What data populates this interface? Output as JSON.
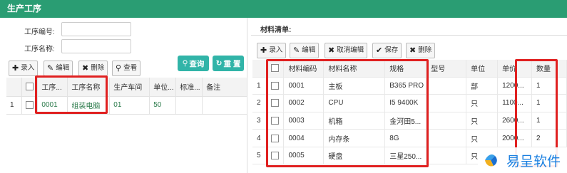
{
  "header": {
    "title": "生产工序"
  },
  "left": {
    "form": {
      "code_label": "工序编号:",
      "name_label": "工序名称:",
      "code_value": "",
      "name_value": ""
    },
    "toolbar": {
      "add": "录入",
      "edit": "编辑",
      "delete": "删除",
      "view": "查看",
      "query": "查询",
      "reset": "重 置"
    },
    "table": {
      "headers": [
        "工序...",
        "工序名称",
        "生产车间",
        "单位...",
        "标准...",
        "备注"
      ],
      "rows": [
        {
          "index": "1",
          "code": "0001",
          "name": "组装电脑",
          "workshop": "01",
          "unit": "50",
          "std": "",
          "note": ""
        }
      ]
    }
  },
  "right": {
    "title": "材料清单:",
    "toolbar": {
      "add": "录入",
      "edit": "编辑",
      "cancel_edit": "取消编辑",
      "save": "保存",
      "delete": "删除"
    },
    "table": {
      "headers": [
        "材料编码",
        "材料名称",
        "规格",
        "型号",
        "单位",
        "单价",
        "数量"
      ],
      "rows": [
        {
          "index": "1",
          "code": "0001",
          "name": "主板",
          "spec": "B365 PRO",
          "model": "",
          "unit": "部",
          "price": "1200...",
          "qty": "1"
        },
        {
          "index": "2",
          "code": "0002",
          "name": "CPU",
          "spec": "I5 9400K",
          "model": "",
          "unit": "只",
          "price": "1100...",
          "qty": "1"
        },
        {
          "index": "3",
          "code": "0003",
          "name": "机箱",
          "spec": "金河田5...",
          "model": "",
          "unit": "只",
          "price": "2600...",
          "qty": "1"
        },
        {
          "index": "4",
          "code": "0004",
          "name": "内存条",
          "spec": "8G",
          "model": "",
          "unit": "只",
          "price": "2000...",
          "qty": "2"
        },
        {
          "index": "5",
          "code": "0005",
          "name": "硬盘",
          "spec": "三星250...",
          "model": "",
          "unit": "只",
          "price": "",
          "qty": ""
        }
      ]
    }
  },
  "watermark": {
    "text": "易呈软件"
  },
  "colors": {
    "header_bg": "#2a9d73",
    "accent_button": "#31b4a8",
    "highlight_box": "#e02020",
    "logo_blue": "#1a7fe0"
  }
}
